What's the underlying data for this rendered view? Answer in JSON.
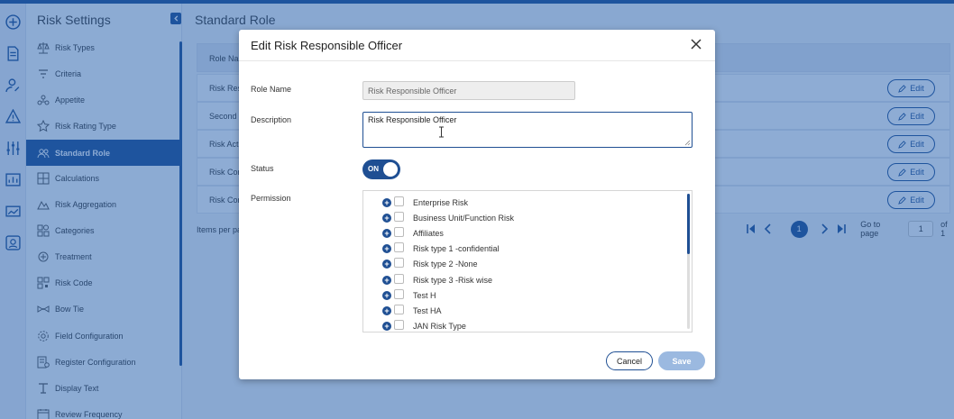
{
  "sidebar": {
    "title": "Risk Settings",
    "items": [
      {
        "label": "Risk Types",
        "icon": "scales-icon"
      },
      {
        "label": "Criteria",
        "icon": "criteria-icon"
      },
      {
        "label": "Appetite",
        "icon": "appetite-icon"
      },
      {
        "label": "Risk Rating Type",
        "icon": "star-icon"
      },
      {
        "label": "Standard Role",
        "icon": "users-icon",
        "active": true
      },
      {
        "label": "Calculations",
        "icon": "calculator-icon"
      },
      {
        "label": "Risk Aggregation",
        "icon": "aggregation-icon"
      },
      {
        "label": "Categories",
        "icon": "categories-icon"
      },
      {
        "label": "Treatment",
        "icon": "treatment-icon"
      },
      {
        "label": "Risk Code",
        "icon": "qr-code-icon"
      },
      {
        "label": "Bow Tie",
        "icon": "bow-tie-icon"
      },
      {
        "label": "Field Configuration",
        "icon": "settings-icon"
      },
      {
        "label": "Register Configuration",
        "icon": "register-icon"
      },
      {
        "label": "Display Text",
        "icon": "text-icon"
      },
      {
        "label": "Review Frequency",
        "icon": "calendar-icon"
      }
    ]
  },
  "main": {
    "title": "Standard Role",
    "table": {
      "header": "Role Nam",
      "rows": [
        {
          "name": "Risk Resp",
          "edit_label": "Edit"
        },
        {
          "name": "Second",
          "edit_label": "Edit"
        },
        {
          "name": "Risk Acti",
          "edit_label": "Edit"
        },
        {
          "name": "Risk Con",
          "edit_label": "Edit"
        },
        {
          "name": "Risk Con",
          "edit_label": "Edit"
        }
      ]
    },
    "items_per_page_label": "Items per pa",
    "pagination": {
      "current_page": "1",
      "go_to_label": "Go to page",
      "go_to_value": "1",
      "of_label": "of 1"
    }
  },
  "modal": {
    "title": "Edit Risk Responsible Officer",
    "role_name_label": "Role Name",
    "role_name_value": "Risk Responsible Officer",
    "description_label": "Description",
    "description_value": "Risk Responsible Officer",
    "status_label": "Status",
    "status_value": "ON",
    "permission_label": "Permission",
    "permissions": [
      "Enterprise Risk",
      "Business Unit/Function Risk",
      "Affiliates",
      "Risk type 1 -confidential",
      "Risk type 2 -None",
      "Risk type 3 -Risk wise",
      "Test H",
      "Test HA",
      "JAN Risk Type"
    ],
    "cancel_label": "Cancel",
    "save_label": "Save"
  },
  "colors": {
    "primary": "#1f4f93",
    "overlay": "#1e5aaa",
    "save_disabled": "#9bb9e0"
  }
}
